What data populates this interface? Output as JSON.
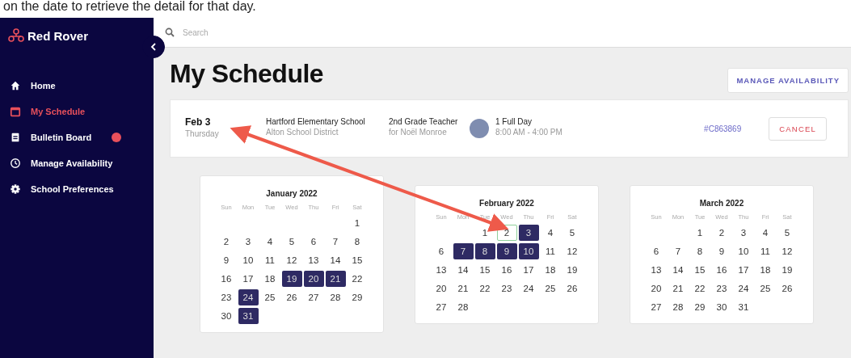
{
  "caption": "on the date to retrieve the detail for that day.",
  "sidebar": {
    "brand": "Red Rover",
    "items": [
      {
        "label": "Home",
        "selected": false,
        "badge": false
      },
      {
        "label": "My Schedule",
        "selected": true,
        "badge": false
      },
      {
        "label": "Bulletin Board",
        "selected": false,
        "badge": true
      },
      {
        "label": "Manage Availability",
        "selected": false,
        "badge": false
      },
      {
        "label": "School Preferences",
        "selected": false,
        "badge": false
      }
    ]
  },
  "search": {
    "placeholder": "Search"
  },
  "page_title": "My Schedule",
  "manage_button": "MANAGE AVAILABILITY",
  "assignment": {
    "date": "Feb 3",
    "weekday": "Thursday",
    "school": "Hartford Elementary School",
    "district": "Alton School District",
    "position": "2nd Grade Teacher",
    "for": "for Noël Monroe",
    "duration": "1 Full Day",
    "hours": "8:00 AM - 4:00 PM",
    "confirmation": "#C863869",
    "cancel": "CANCEL"
  },
  "calendars": [
    {
      "title": "January 2022",
      "weekdays": [
        "Sun",
        "Mon",
        "Tue",
        "Wed",
        "Thu",
        "Fri",
        "Sat"
      ],
      "weeks": [
        [
          {
            "day": "1",
            "selected": false,
            "outlined": false
          }
        ],
        [
          {
            "day": "2",
            "selected": false,
            "outlined": false
          },
          {
            "day": "3",
            "selected": false,
            "outlined": false
          },
          {
            "day": "4",
            "selected": false,
            "outlined": false
          },
          {
            "day": "5",
            "selected": false,
            "outlined": false
          },
          {
            "day": "6",
            "selected": false,
            "outlined": false
          },
          {
            "day": "7",
            "selected": false,
            "outlined": false
          },
          {
            "day": "8",
            "selected": false,
            "outlined": false
          }
        ],
        [
          {
            "day": "9",
            "selected": false,
            "outlined": false
          },
          {
            "day": "10",
            "selected": false,
            "outlined": false
          },
          {
            "day": "11",
            "selected": false,
            "outlined": false
          },
          {
            "day": "12",
            "selected": false,
            "outlined": false
          },
          {
            "day": "13",
            "selected": false,
            "outlined": false
          },
          {
            "day": "14",
            "selected": false,
            "outlined": false
          },
          {
            "day": "15",
            "selected": false,
            "outlined": false
          }
        ],
        [
          {
            "day": "16",
            "selected": false,
            "outlined": false
          },
          {
            "day": "17",
            "selected": false,
            "outlined": false
          },
          {
            "day": "18",
            "selected": false,
            "outlined": false
          },
          {
            "day": "19",
            "selected": true,
            "outlined": false
          },
          {
            "day": "20",
            "selected": true,
            "outlined": false
          },
          {
            "day": "21",
            "selected": true,
            "outlined": false
          },
          {
            "day": "22",
            "selected": false,
            "outlined": false
          }
        ],
        [
          {
            "day": "23",
            "selected": false,
            "outlined": false
          },
          {
            "day": "24",
            "selected": true,
            "outlined": false
          },
          {
            "day": "25",
            "selected": false,
            "outlined": false
          },
          {
            "day": "26",
            "selected": false,
            "outlined": false
          },
          {
            "day": "27",
            "selected": false,
            "outlined": false
          },
          {
            "day": "28",
            "selected": false,
            "outlined": false
          },
          {
            "day": "29",
            "selected": false,
            "outlined": false
          }
        ],
        [
          {
            "day": "30",
            "selected": false,
            "outlined": false
          },
          {
            "day": "31",
            "selected": true,
            "outlined": false
          }
        ]
      ]
    },
    {
      "title": "February 2022",
      "weekdays": [
        "Sun",
        "Mon",
        "Tue",
        "Wed",
        "Thu",
        "Fri",
        "Sat"
      ],
      "weeks": [
        [
          {
            "day": "1",
            "selected": false,
            "outlined": false
          },
          {
            "day": "2",
            "selected": false,
            "outlined": true
          },
          {
            "day": "3",
            "selected": true,
            "outlined": false
          },
          {
            "day": "4",
            "selected": false,
            "outlined": false
          },
          {
            "day": "5",
            "selected": false,
            "outlined": false
          }
        ],
        [
          {
            "day": "6",
            "selected": false,
            "outlined": false
          },
          {
            "day": "7",
            "selected": true,
            "outlined": false
          },
          {
            "day": "8",
            "selected": true,
            "outlined": false
          },
          {
            "day": "9",
            "selected": true,
            "outlined": false
          },
          {
            "day": "10",
            "selected": true,
            "outlined": false
          },
          {
            "day": "11",
            "selected": false,
            "outlined": false
          },
          {
            "day": "12",
            "selected": false,
            "outlined": false
          }
        ],
        [
          {
            "day": "13",
            "selected": false,
            "outlined": false
          },
          {
            "day": "14",
            "selected": false,
            "outlined": false
          },
          {
            "day": "15",
            "selected": false,
            "outlined": false
          },
          {
            "day": "16",
            "selected": false,
            "outlined": false
          },
          {
            "day": "17",
            "selected": false,
            "outlined": false
          },
          {
            "day": "18",
            "selected": false,
            "outlined": false
          },
          {
            "day": "19",
            "selected": false,
            "outlined": false
          }
        ],
        [
          {
            "day": "20",
            "selected": false,
            "outlined": false
          },
          {
            "day": "21",
            "selected": false,
            "outlined": false
          },
          {
            "day": "22",
            "selected": false,
            "outlined": false
          },
          {
            "day": "23",
            "selected": false,
            "outlined": false
          },
          {
            "day": "24",
            "selected": false,
            "outlined": false
          },
          {
            "day": "25",
            "selected": false,
            "outlined": false
          },
          {
            "day": "26",
            "selected": false,
            "outlined": false
          }
        ],
        [
          {
            "day": "27",
            "selected": false,
            "outlined": false
          },
          {
            "day": "28",
            "selected": false,
            "outlined": false
          }
        ]
      ]
    },
    {
      "title": "March 2022",
      "weekdays": [
        "Sun",
        "Mon",
        "Tue",
        "Wed",
        "Thu",
        "Fri",
        "Sat"
      ],
      "weeks": [
        [
          {
            "day": "1",
            "selected": false,
            "outlined": false
          },
          {
            "day": "2",
            "selected": false,
            "outlined": false
          },
          {
            "day": "3",
            "selected": false,
            "outlined": false
          },
          {
            "day": "4",
            "selected": false,
            "outlined": false
          },
          {
            "day": "5",
            "selected": false,
            "outlined": false
          }
        ],
        [
          {
            "day": "6",
            "selected": false,
            "outlined": false
          },
          {
            "day": "7",
            "selected": false,
            "outlined": false
          },
          {
            "day": "8",
            "selected": false,
            "outlined": false
          },
          {
            "day": "9",
            "selected": false,
            "outlined": false
          },
          {
            "day": "10",
            "selected": false,
            "outlined": false
          },
          {
            "day": "11",
            "selected": false,
            "outlined": false
          },
          {
            "day": "12",
            "selected": false,
            "outlined": false
          }
        ],
        [
          {
            "day": "13",
            "selected": false,
            "outlined": false
          },
          {
            "day": "14",
            "selected": false,
            "outlined": false
          },
          {
            "day": "15",
            "selected": false,
            "outlined": false
          },
          {
            "day": "16",
            "selected": false,
            "outlined": false
          },
          {
            "day": "17",
            "selected": false,
            "outlined": false
          },
          {
            "day": "18",
            "selected": false,
            "outlined": false
          },
          {
            "day": "19",
            "selected": false,
            "outlined": false
          }
        ],
        [
          {
            "day": "20",
            "selected": false,
            "outlined": false
          },
          {
            "day": "21",
            "selected": false,
            "outlined": false
          },
          {
            "day": "22",
            "selected": false,
            "outlined": false
          },
          {
            "day": "23",
            "selected": false,
            "outlined": false
          },
          {
            "day": "24",
            "selected": false,
            "outlined": false
          },
          {
            "day": "25",
            "selected": false,
            "outlined": false
          },
          {
            "day": "26",
            "selected": false,
            "outlined": false
          }
        ],
        [
          {
            "day": "27",
            "selected": false,
            "outlined": false
          },
          {
            "day": "28",
            "selected": false,
            "outlined": false
          },
          {
            "day": "29",
            "selected": false,
            "outlined": false
          },
          {
            "day": "30",
            "selected": false,
            "outlined": false
          },
          {
            "day": "31",
            "selected": false,
            "outlined": false
          }
        ]
      ]
    }
  ]
}
